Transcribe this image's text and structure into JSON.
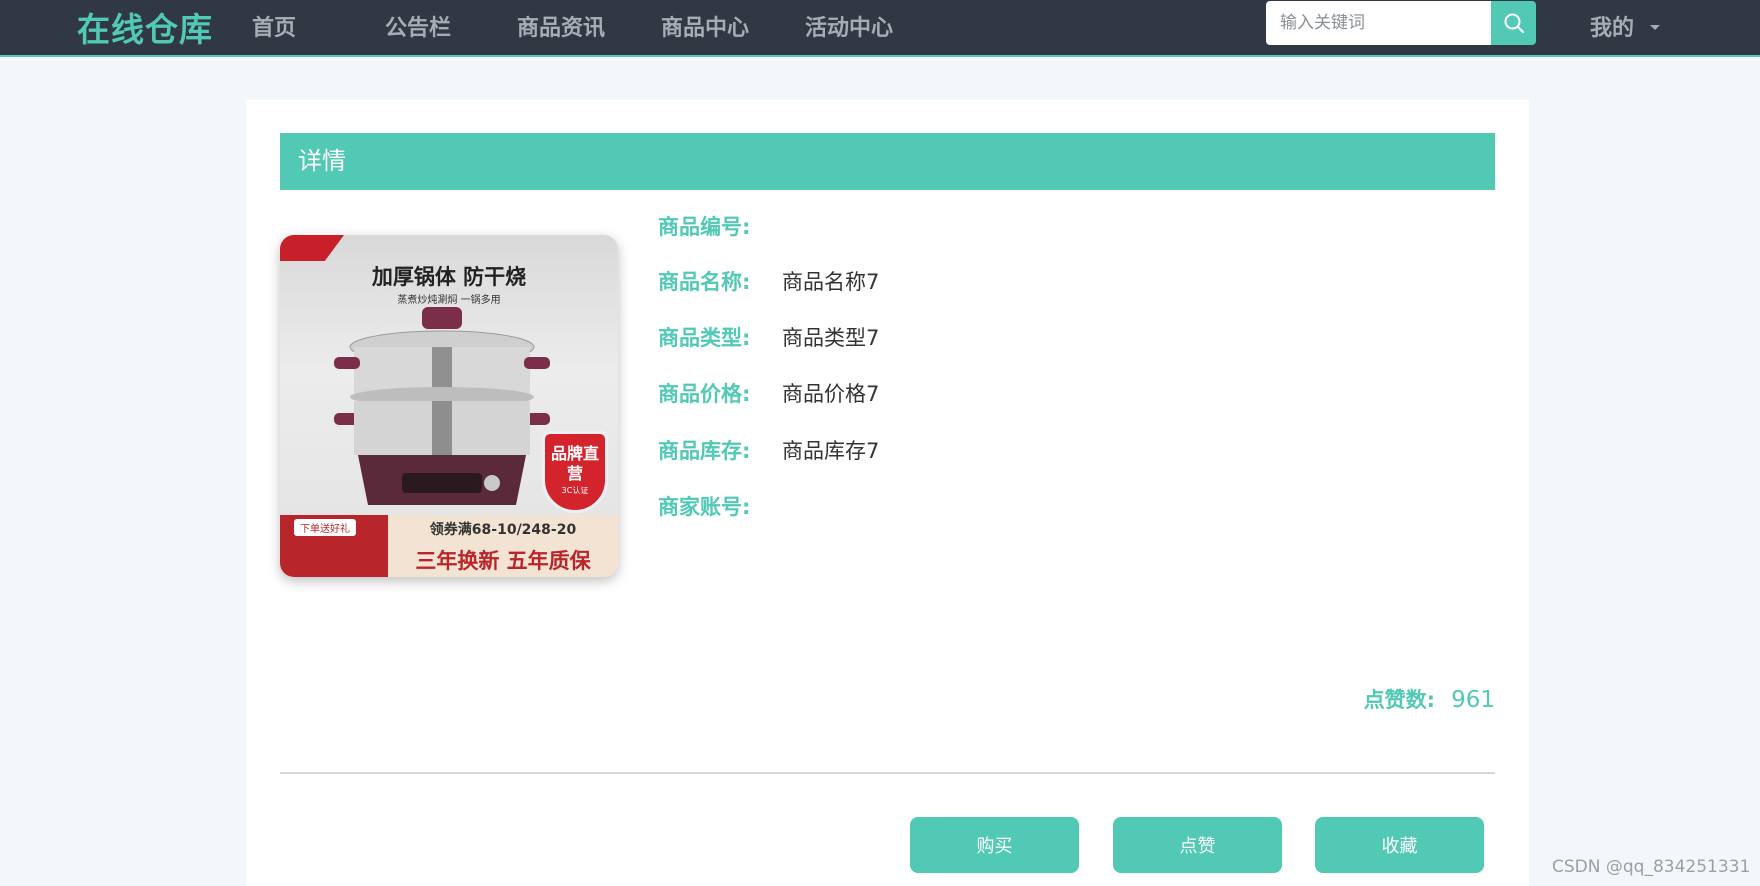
{
  "navbar": {
    "brand": "在线仓库",
    "items": [
      {
        "label": "首页"
      },
      {
        "label": "公告栏"
      },
      {
        "label": "商品资讯"
      },
      {
        "label": "商品中心"
      },
      {
        "label": "活动中心"
      }
    ],
    "search": {
      "placeholder": "输入关键词",
      "value": ""
    },
    "user_menu": "我的"
  },
  "detail": {
    "header": "详情",
    "image": {
      "headline": "加厚锅体 防干烧",
      "subline": "蒸煮炒炖涮焖  一锅多用",
      "badge": "品牌直营",
      "badge_sub": "3C认证",
      "gift": "下单送好礼",
      "coupon": "领券满68-10/248-20",
      "warranty": "三年换新 五年质保"
    },
    "fields": [
      {
        "label": "商品编号:",
        "value": ""
      },
      {
        "label": "商品名称:",
        "value": "商品名称7"
      },
      {
        "label": "商品类型:",
        "value": "商品类型7"
      },
      {
        "label": "商品价格:",
        "value": "商品价格7"
      },
      {
        "label": "商品库存:",
        "value": "商品库存7"
      },
      {
        "label": "商家账号:",
        "value": ""
      }
    ],
    "likes_label": "点赞数:",
    "likes_value": "961"
  },
  "actions": {
    "buy": "购买",
    "like": "点赞",
    "favorite": "收藏"
  },
  "watermark": "CSDN @qq_834251331",
  "colors": {
    "accent": "#52c9b4",
    "navbar_bg": "#2f3843",
    "page_bg": "#f3f7f9"
  },
  "icons": {
    "search": "search-icon",
    "dropdown": "caret-down-icon"
  }
}
